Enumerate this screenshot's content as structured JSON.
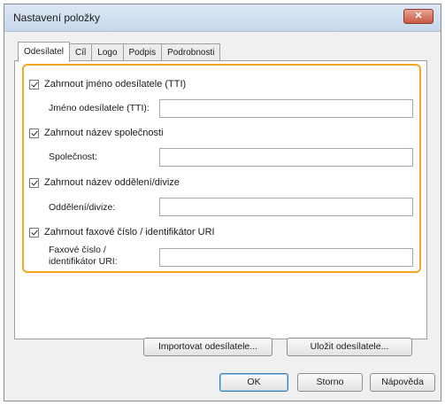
{
  "dialog": {
    "title": "Nastavení položky",
    "close_glyph": "✕"
  },
  "tabs": [
    {
      "label": "Odesílatel",
      "active": true
    },
    {
      "label": "Cíl",
      "active": false
    },
    {
      "label": "Logo",
      "active": false
    },
    {
      "label": "Podpis",
      "active": false
    },
    {
      "label": "Podrobnosti",
      "active": false
    }
  ],
  "sender": {
    "include_tti": {
      "label": "Zahrnout jméno odesílatele (TTI)",
      "checked": true
    },
    "tti_name": {
      "label": "Jméno odesílatele (TTI):",
      "value": ""
    },
    "include_company": {
      "label": "Zahrnout název společnosti",
      "checked": true
    },
    "company": {
      "label": "Společnost:",
      "value": ""
    },
    "include_department": {
      "label": "Zahrnout název oddělení/divize",
      "checked": true
    },
    "department": {
      "label": "Oddělení/divize:",
      "value": ""
    },
    "include_fax": {
      "label": "Zahrnout faxové číslo / identifikátor URI",
      "checked": true
    },
    "fax": {
      "label_line1": "Faxové číslo /",
      "label_line2": "identifikátor URI:",
      "value": ""
    }
  },
  "actions": {
    "import_label": "Importovat odesílatele...",
    "save_label": "Uložit odesílatele..."
  },
  "footer": {
    "ok_label": "OK",
    "cancel_label": "Storno",
    "help_label": "Nápověda"
  },
  "colors": {
    "highlight": "#f5a623",
    "titlebar": "#c7d8ec",
    "close_button": "#c75a45"
  }
}
